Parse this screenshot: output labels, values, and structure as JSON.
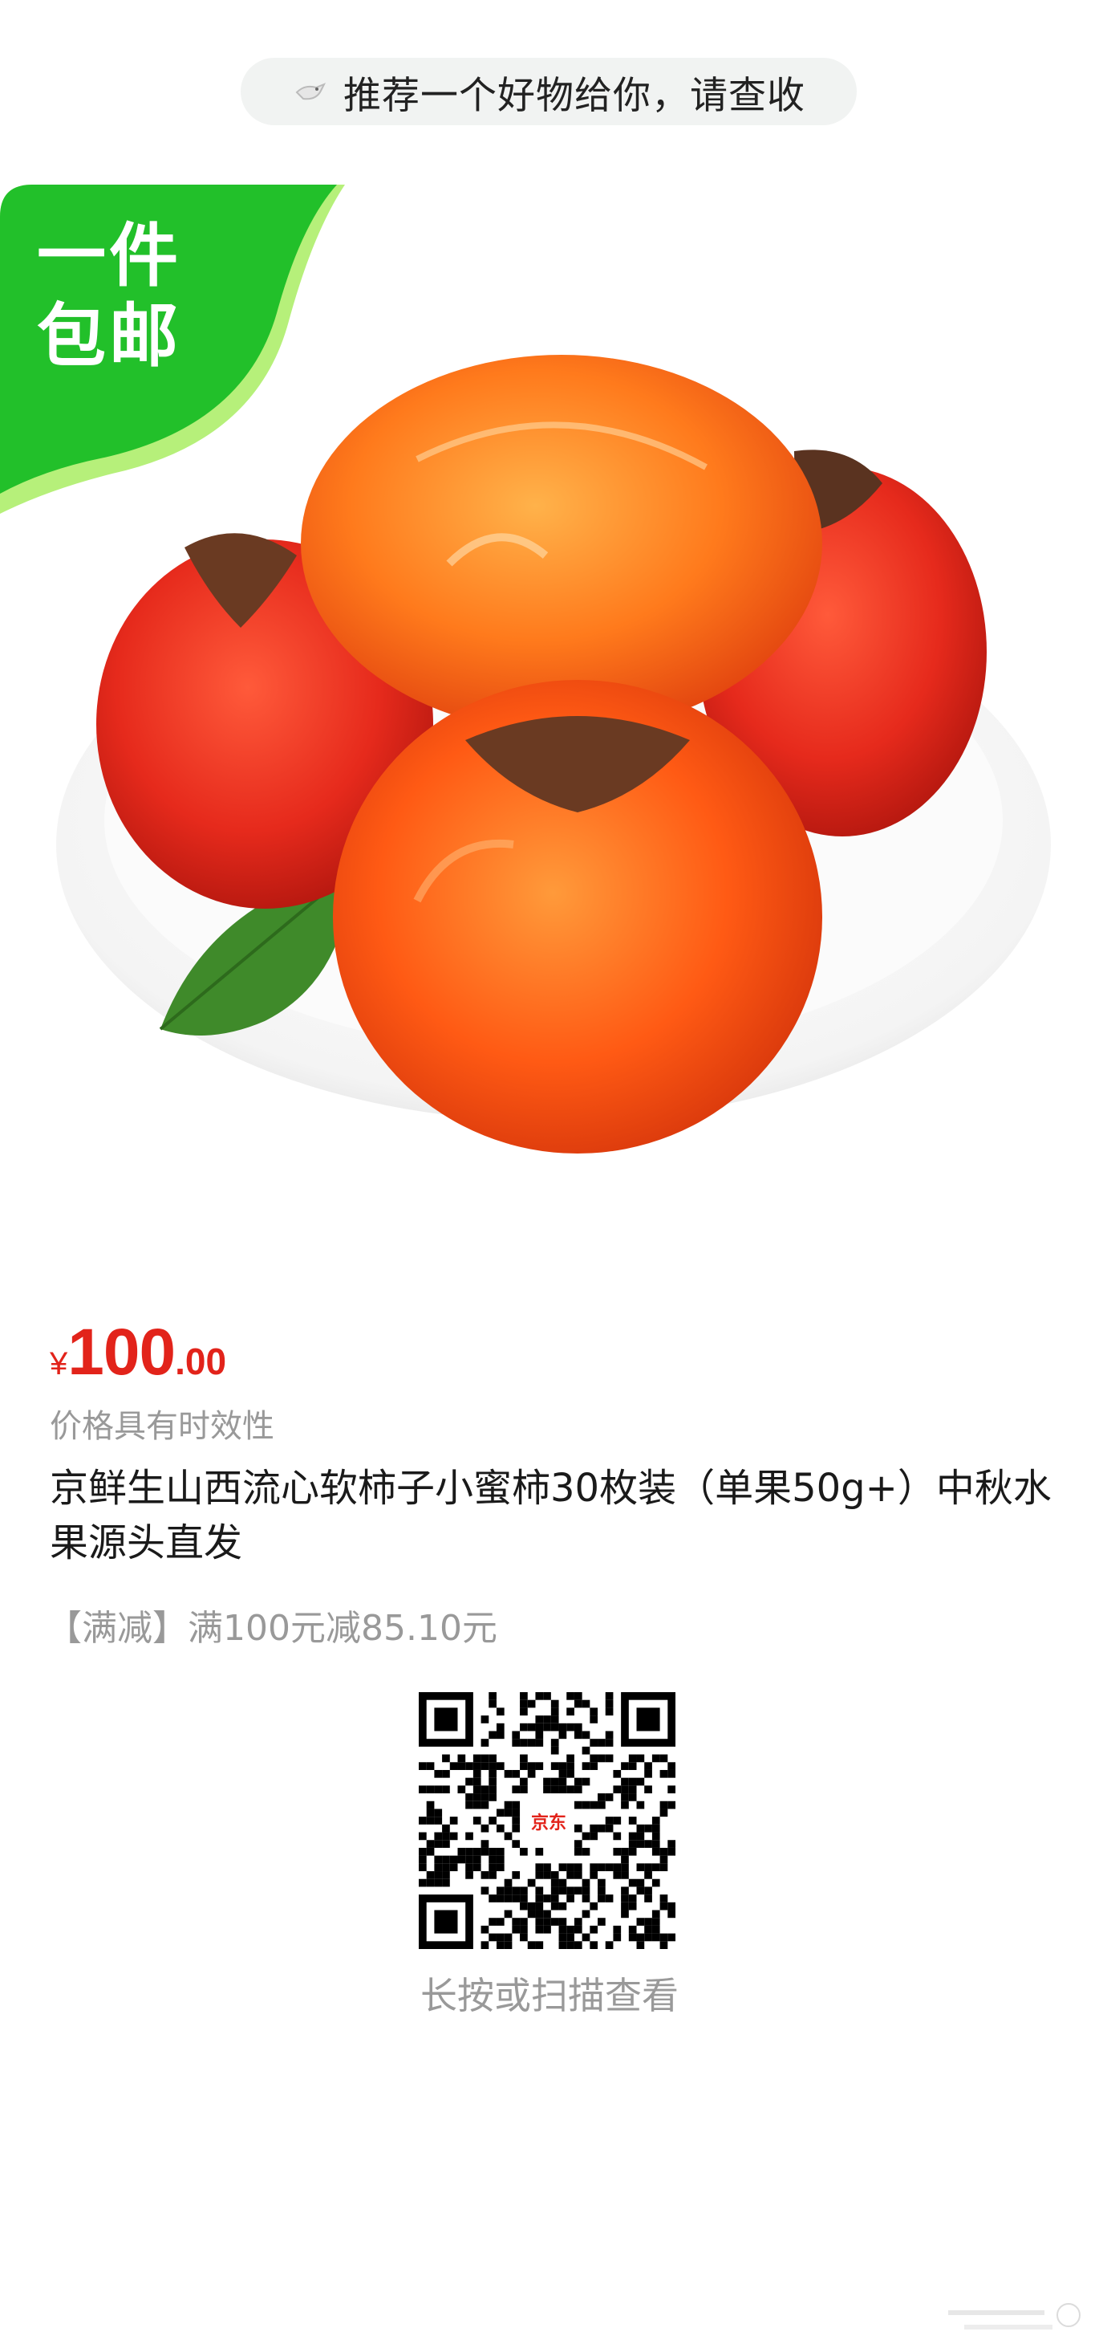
{
  "share_header": {
    "text": "推荐一个好物给你，请查收"
  },
  "badge": {
    "line1": "一件",
    "line2": "包邮",
    "color": "#22c02a"
  },
  "product": {
    "price": {
      "currency": "¥",
      "integer": "100",
      "decimal": ".00",
      "color": "#e2231a"
    },
    "price_note": "价格具有时效性",
    "title": "京鲜生山西流心软柿子小蜜柿30枚装（单果50g+）中秋水果源头直发",
    "promo": "【满减】满100元减85.10元"
  },
  "qr": {
    "logo_text": "京东",
    "caption": "长按或扫描查看"
  }
}
